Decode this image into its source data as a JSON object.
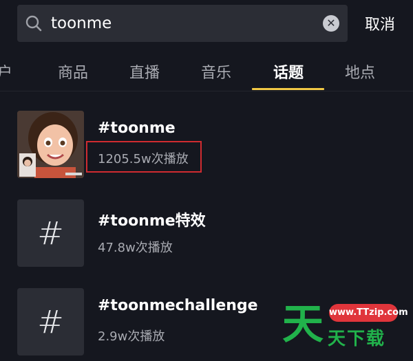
{
  "search": {
    "query": "toonme",
    "clear_icon": "close-circle-icon",
    "search_icon": "magnifier-icon"
  },
  "header": {
    "cancel_label": "取消"
  },
  "tabs": [
    {
      "label": "户"
    },
    {
      "label": "商品"
    },
    {
      "label": "直播"
    },
    {
      "label": "音乐"
    },
    {
      "label": "话题",
      "active": true
    },
    {
      "label": "地点"
    }
  ],
  "results": [
    {
      "title": "#toonme",
      "plays": "1205.5w次播放",
      "highlighted": true,
      "thumb": "cartoon-avatar-image"
    },
    {
      "title": "#toonme特效",
      "plays": "47.8w次播放",
      "hash_glyph": "#"
    },
    {
      "title": "#toonmechallenge",
      "plays": "2.9w次播放",
      "hash_glyph": "#"
    }
  ],
  "watermark": {
    "big_char": "天",
    "url": "www.TTzip.com",
    "text": "天下载"
  },
  "colors": {
    "background": "#15171f",
    "tab_underline": "#f2c945",
    "highlight": "#d12b30",
    "watermark_green": "#21b24b",
    "watermark_red": "#e0353b"
  }
}
